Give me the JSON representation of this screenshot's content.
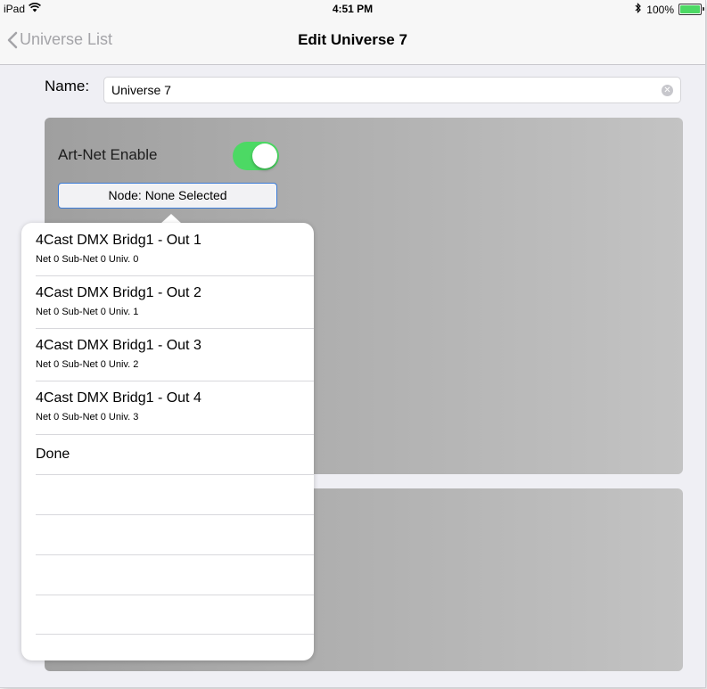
{
  "status_bar": {
    "device": "iPad",
    "time": "4:51 PM",
    "battery": "100%",
    "battery_level": 1.0
  },
  "nav": {
    "back_label": "Universe List",
    "title": "Edit Universe 7"
  },
  "form": {
    "name_label": "Name:",
    "name_value": "Universe 7",
    "artnet_label": "Art-Net Enable",
    "artnet_enabled": true,
    "node_button": "Node: None Selected"
  },
  "popover": {
    "items": [
      {
        "title": "4Cast DMX Bridg1 - Out 1",
        "subtitle": "Net 0  Sub-Net 0 Univ. 0"
      },
      {
        "title": "4Cast DMX Bridg1 - Out 2",
        "subtitle": "Net 0  Sub-Net 0 Univ. 1"
      },
      {
        "title": "4Cast DMX Bridg1 - Out 3",
        "subtitle": "Net 0  Sub-Net 0 Univ. 2"
      },
      {
        "title": "4Cast DMX Bridg1 - Out 4",
        "subtitle": "Net 0  Sub-Net 0 Univ. 3"
      }
    ],
    "done_label": "Done"
  },
  "colors": {
    "toggle_on": "#4cd964",
    "button_border": "#3b7bd6",
    "battery": "#4cd964"
  },
  "icons": [
    "wifi-icon",
    "bluetooth-icon",
    "battery-icon",
    "chevron-left-icon",
    "clear-icon"
  ]
}
